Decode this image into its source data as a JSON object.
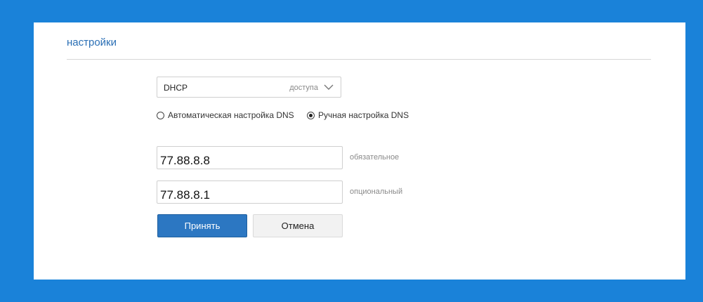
{
  "panel": {
    "title": "настройки"
  },
  "connection": {
    "selected_value": "DHCP",
    "hint": "доступа"
  },
  "dns_mode": {
    "auto_label": "Автоматическая настройка DNS",
    "manual_label": "Ручная настройка DNS",
    "selected": "manual"
  },
  "dns_fields": {
    "primary_value": "77.88.8.8",
    "primary_hint": "обязательное",
    "secondary_value": "77.88.8.1",
    "secondary_hint": "опциональный"
  },
  "actions": {
    "accept_label": "Принять",
    "cancel_label": "Отмена"
  },
  "colors": {
    "background": "#1a82d9",
    "accent": "#2c77c2",
    "title": "#2a6fb5"
  }
}
